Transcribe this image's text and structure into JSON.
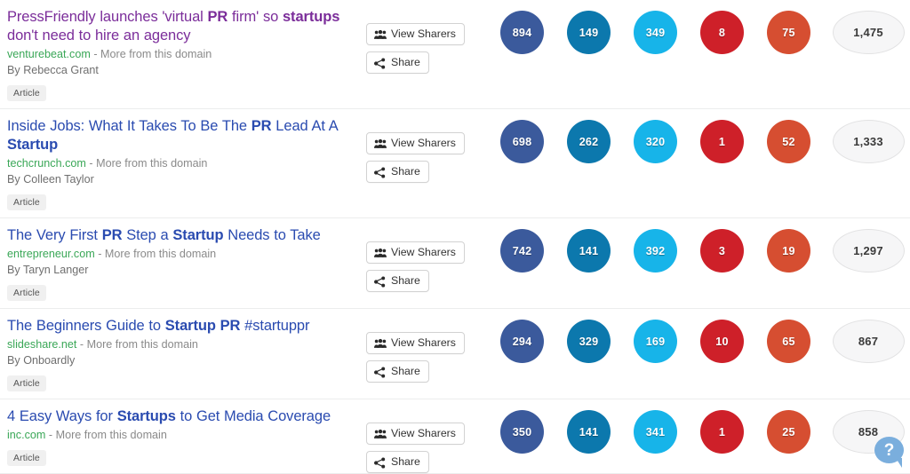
{
  "colors": {
    "facebook": "#3b5a9c",
    "linkedin": "#0c78ad",
    "twitter": "#17b4e9",
    "googleplus": "#ce2029",
    "stumbleupon": "#d64e31",
    "total_bg": "#f6f6f7",
    "title_link": "#2a4bb0",
    "title_visited": "#7b2d9a",
    "domain_link": "#3aa757",
    "help_bubble": "#7aaedd"
  },
  "buttons": {
    "view_sharers_label": "View Sharers",
    "share_label": "Share",
    "view_sharers_icon": "group-users-icon",
    "share_icon": "share-alt-icon"
  },
  "badge_label": "Article",
  "domain_more_label": "- More from this domain",
  "help": {
    "icon": "question-mark-speech-bubble-icon",
    "label": "?"
  },
  "results": [
    {
      "title_parts": [
        {
          "text": "PressFriendly launches 'virtual ",
          "bold": false
        },
        {
          "text": "PR",
          "bold": true
        },
        {
          "text": " firm' so ",
          "bold": false
        },
        {
          "text": "startups",
          "bold": true
        },
        {
          "text": " don't need to hire an agency",
          "bold": false
        }
      ],
      "title_plain": "PressFriendly launches 'virtual PR firm' so startups don't need to hire an agency",
      "visited": true,
      "domain": "venturebeat.com",
      "author": "By Rebecca Grant",
      "badge": "Article",
      "metrics": [
        {
          "network": "facebook",
          "value": "894"
        },
        {
          "network": "linkedin",
          "value": "149"
        },
        {
          "network": "twitter",
          "value": "349"
        },
        {
          "network": "googleplus",
          "value": "8"
        },
        {
          "network": "stumbleupon",
          "value": "75"
        }
      ],
      "total": "1,475"
    },
    {
      "title_parts": [
        {
          "text": "Inside Jobs: What It Takes To Be The ",
          "bold": false
        },
        {
          "text": "PR",
          "bold": true
        },
        {
          "text": " Lead At A ",
          "bold": false
        },
        {
          "text": "Startup",
          "bold": true
        }
      ],
      "title_plain": "Inside Jobs: What It Takes To Be The PR Lead At A Startup",
      "visited": false,
      "domain": "techcrunch.com",
      "author": "By Colleen Taylor",
      "badge": "Article",
      "metrics": [
        {
          "network": "facebook",
          "value": "698"
        },
        {
          "network": "linkedin",
          "value": "262"
        },
        {
          "network": "twitter",
          "value": "320"
        },
        {
          "network": "googleplus",
          "value": "1"
        },
        {
          "network": "stumbleupon",
          "value": "52"
        }
      ],
      "total": "1,333"
    },
    {
      "title_parts": [
        {
          "text": "The Very First ",
          "bold": false
        },
        {
          "text": "PR",
          "bold": true
        },
        {
          "text": " Step a ",
          "bold": false
        },
        {
          "text": "Startup",
          "bold": true
        },
        {
          "text": " Needs to Take",
          "bold": false
        }
      ],
      "title_plain": "The Very First PR Step a Startup Needs to Take",
      "visited": false,
      "domain": "entrepreneur.com",
      "author": "By Taryn Langer",
      "badge": "Article",
      "metrics": [
        {
          "network": "facebook",
          "value": "742"
        },
        {
          "network": "linkedin",
          "value": "141"
        },
        {
          "network": "twitter",
          "value": "392"
        },
        {
          "network": "googleplus",
          "value": "3"
        },
        {
          "network": "stumbleupon",
          "value": "19"
        }
      ],
      "total": "1,297"
    },
    {
      "title_parts": [
        {
          "text": "The Beginners Guide to ",
          "bold": false
        },
        {
          "text": "Startup PR",
          "bold": true
        },
        {
          "text": " #startuppr",
          "bold": false
        }
      ],
      "title_plain": "The Beginners Guide to Startup PR #startuppr",
      "visited": false,
      "domain": "slideshare.net",
      "author": "By Onboardly",
      "badge": "Article",
      "metrics": [
        {
          "network": "facebook",
          "value": "294"
        },
        {
          "network": "linkedin",
          "value": "329"
        },
        {
          "network": "twitter",
          "value": "169"
        },
        {
          "network": "googleplus",
          "value": "10"
        },
        {
          "network": "stumbleupon",
          "value": "65"
        }
      ],
      "total": "867"
    },
    {
      "title_parts": [
        {
          "text": "4 Easy Ways for ",
          "bold": false
        },
        {
          "text": "Startups",
          "bold": true
        },
        {
          "text": " to Get Media Coverage",
          "bold": false
        }
      ],
      "title_plain": "4 Easy Ways for Startups to Get Media Coverage",
      "visited": false,
      "domain": "inc.com",
      "author": "",
      "badge": "Article",
      "metrics": [
        {
          "network": "facebook",
          "value": "350"
        },
        {
          "network": "linkedin",
          "value": "141"
        },
        {
          "network": "twitter",
          "value": "341"
        },
        {
          "network": "googleplus",
          "value": "1"
        },
        {
          "network": "stumbleupon",
          "value": "25"
        }
      ],
      "total": "858"
    }
  ]
}
